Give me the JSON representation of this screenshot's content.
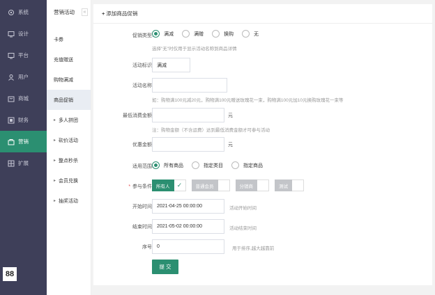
{
  "nav": {
    "items": [
      {
        "label": "系统",
        "icon": "gear-icon"
      },
      {
        "label": "设计",
        "icon": "monitor-icon"
      },
      {
        "label": "平台",
        "icon": "monitor-icon"
      },
      {
        "label": "用户",
        "icon": "user-icon"
      },
      {
        "label": "商城",
        "icon": "shop-icon"
      },
      {
        "label": "财务",
        "icon": "finance-icon"
      },
      {
        "label": "营销",
        "icon": "marketing-icon"
      },
      {
        "label": "扩展",
        "icon": "extend-icon"
      }
    ],
    "active_index": 6,
    "accent": "#2b8f71",
    "bottom_logo": "88"
  },
  "subnav": {
    "title": "营销活动",
    "collapse": "«",
    "items": [
      {
        "label": "卡券"
      },
      {
        "label": "充值赠送"
      },
      {
        "label": "购物满减"
      },
      {
        "label": "商品促销"
      }
    ],
    "groups": [
      {
        "label": "多人拼团"
      },
      {
        "label": "砍价活动"
      },
      {
        "label": "整点秒杀"
      },
      {
        "label": "会员兑换"
      },
      {
        "label": "抽奖活动"
      }
    ],
    "active_index": 3
  },
  "page": {
    "title": "添加商品促销",
    "plus": "+"
  },
  "form": {
    "promo_type": {
      "label": "促销类型:",
      "options": [
        "满减",
        "满赠",
        "换购",
        "无"
      ],
      "selected": "满减",
      "hint": "选择\"无\"时仅用于显示活动名称到商品详情"
    },
    "tag": {
      "label": "活动标识:",
      "value": "满减"
    },
    "name": {
      "label": "活动名称:",
      "value": "",
      "hint": "如：购物满100元减20元，购物满100元赠送玫瑰花一束，购物满100元加10元换购玫瑰花一束等"
    },
    "min_amount": {
      "label": "最低消费金额:",
      "value": "",
      "unit": "元",
      "hint": "注：购物金额（不含运费）达到最低消费金额才可参与活动"
    },
    "discount": {
      "label": "优惠金额:",
      "value": "",
      "unit": "元"
    },
    "scope": {
      "label": "适用范围:",
      "options": [
        "所有商品",
        "指定类目",
        "指定商品"
      ],
      "selected": "所有商品"
    },
    "conditions": {
      "label": "参与条件:",
      "required_mark": "*",
      "tags": [
        {
          "label": "所有人",
          "on": true
        },
        {
          "label": "普通会员",
          "on": false
        },
        {
          "label": "分销商",
          "on": false
        },
        {
          "label": "测试",
          "on": false
        }
      ],
      "check": "✓"
    },
    "start": {
      "label": "开始时间:",
      "value": "2021-04-25 00:00:00",
      "hint": "活动开始时间"
    },
    "end": {
      "label": "结束时间:",
      "value": "2021-05-02 00:00:00",
      "hint": "活动结束时间"
    },
    "order": {
      "label": "序号:",
      "value": "0",
      "hint": "用于排序,越大越靠前"
    },
    "submit_label": "提 交"
  }
}
